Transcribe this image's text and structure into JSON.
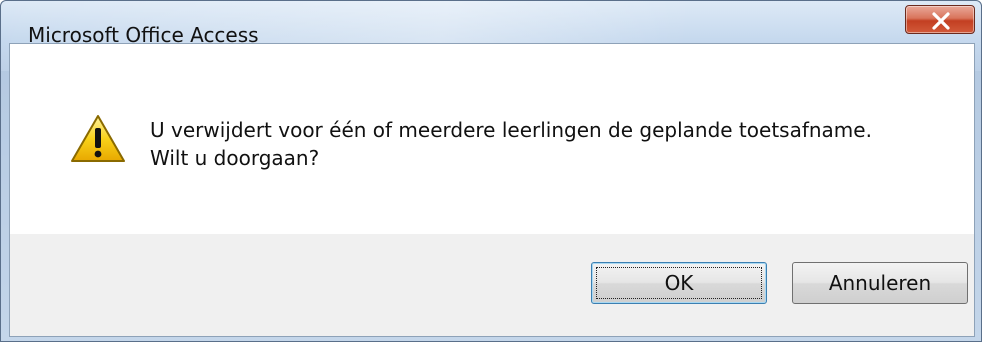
{
  "window": {
    "title": "Microsoft Office Access"
  },
  "dialog": {
    "icon": "warning-icon",
    "message_line1": "U verwijdert voor één of meerdere leerlingen de geplande toetsafname.",
    "message_line2": "Wilt u doorgaan?"
  },
  "buttons": {
    "ok_label": "OK",
    "cancel_label": "Annuleren"
  },
  "colors": {
    "close_button": "#c33f22",
    "warning_yellow": "#f5c400",
    "ok_focus_border": "#3c7fb1"
  }
}
